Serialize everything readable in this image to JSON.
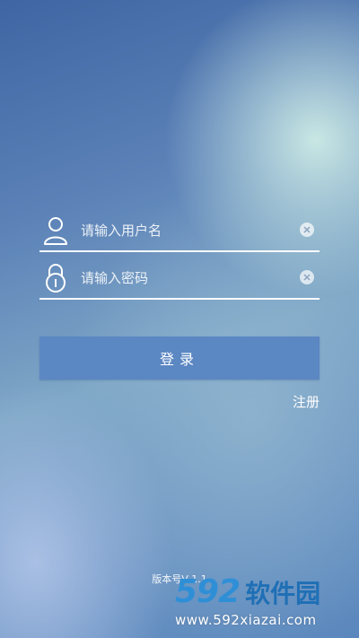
{
  "login_form": {
    "username": {
      "placeholder": "请输入用户名",
      "icon": "user-icon"
    },
    "password": {
      "placeholder": "请输入密码",
      "icon": "lock-icon"
    },
    "clear_icon": "clear-icon",
    "login_label": "登录",
    "register_label": "注册"
  },
  "footer": {
    "version": "版本号V 1.1"
  },
  "watermark": {
    "number": "592",
    "name": "软件园",
    "url": "www.592xiazai.com"
  },
  "colors": {
    "button": "#5b87c3",
    "watermark_blue": "#2f8fd6"
  }
}
